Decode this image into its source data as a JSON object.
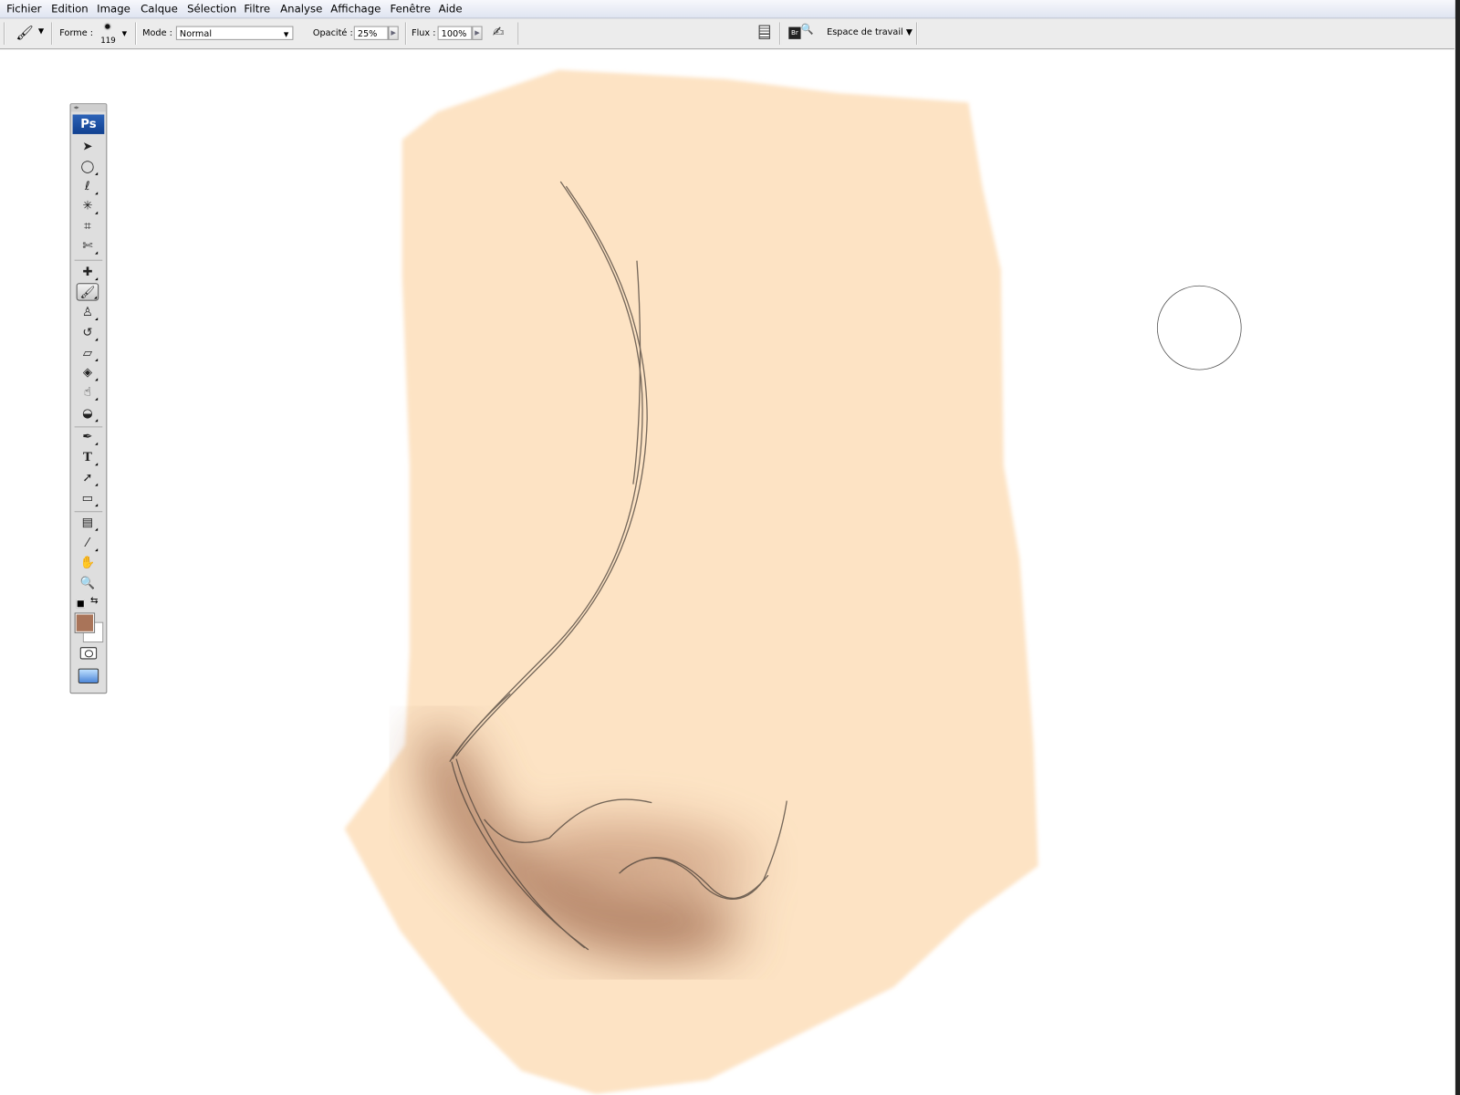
{
  "menu": [
    "Fichier",
    "Edition",
    "Image",
    "Calque",
    "Sélection",
    "Filtre",
    "Analyse",
    "Affichage",
    "Fenêtre",
    "Aide"
  ],
  "options": {
    "shape_label": "Forme :",
    "brush_size": "119",
    "mode_label": "Mode :",
    "mode_value": "Normal",
    "opacity_label": "Opacité :",
    "opacity_value": "25%",
    "flow_label": "Flux :",
    "flow_value": "100%",
    "workspace_label": "Espace de travail"
  },
  "toolbox": {
    "logo": "Ps",
    "foreground_color": "#a97459",
    "background_color": "#ffffff",
    "tools": [
      "move",
      "marquee-ellipse",
      "lasso",
      "magic-wand",
      "crop",
      "slice",
      "healing-brush",
      "brush",
      "clone-stamp",
      "history-brush",
      "eraser",
      "paint-bucket",
      "blur",
      "dodge",
      "pen",
      "type",
      "path-selection",
      "rectangle",
      "notes",
      "eyedropper",
      "hand",
      "zoom"
    ]
  },
  "canvas": {
    "skin_color": "#fde3c4",
    "shadow_color": "#a87458"
  }
}
